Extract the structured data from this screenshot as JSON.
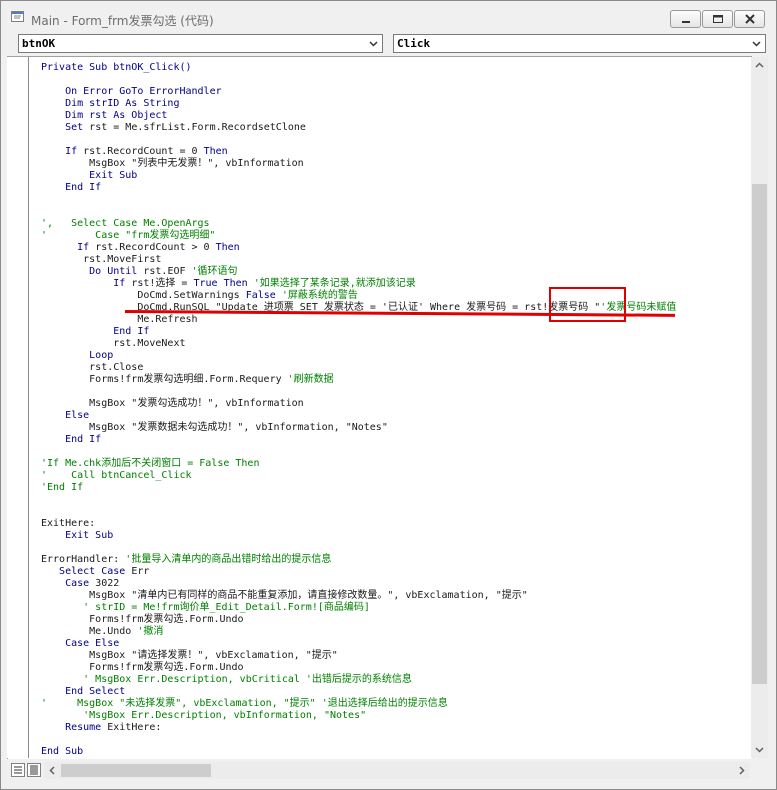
{
  "window": {
    "title": "Main - Form_frm发票勾选 (代码)"
  },
  "object_combo": {
    "value": "btnOK"
  },
  "proc_combo": {
    "value": "Click"
  },
  "code": [
    [
      [
        "kw",
        "Private Sub btnOK_Click()"
      ]
    ],
    [],
    [
      [
        "kw",
        "    On Error GoTo ErrorHandler"
      ]
    ],
    [
      [
        "kw",
        "    Dim strID As String"
      ]
    ],
    [
      [
        "kw",
        "    Dim rst As Object"
      ]
    ],
    [
      [
        "kw",
        "    Set "
      ],
      [
        "t",
        "rst = Me.sfrList.Form.RecordsetClone"
      ]
    ],
    [],
    [
      [
        "kw",
        "    If "
      ],
      [
        "t",
        "rst.RecordCount = 0 "
      ],
      [
        "kw",
        "Then"
      ]
    ],
    [
      [
        "t",
        "        MsgBox \"列表中无发票！\", vbInformation"
      ]
    ],
    [
      [
        "kw",
        "        Exit Sub"
      ]
    ],
    [
      [
        "kw",
        "    End If"
      ]
    ],
    [],
    [],
    [
      [
        "cm",
        "',   Select Case Me.OpenArgs"
      ]
    ],
    [
      [
        "cm",
        "'        Case \"frm发票勾选明细\""
      ]
    ],
    [
      [
        "kw",
        "      If "
      ],
      [
        "t",
        "rst.RecordCount > 0 "
      ],
      [
        "kw",
        "Then"
      ]
    ],
    [
      [
        "t",
        "       rst.MoveFirst"
      ]
    ],
    [
      [
        "kw",
        "        Do Until "
      ],
      [
        "t",
        "rst.EOF "
      ],
      [
        "cm",
        "'循环语句"
      ]
    ],
    [
      [
        "kw",
        "            If "
      ],
      [
        "t",
        "rst!选择 = "
      ],
      [
        "kw",
        "True Then "
      ],
      [
        "cm",
        "'如果选择了某条记录,就添加该记录"
      ]
    ],
    [
      [
        "t",
        "                DoCmd.SetWarnings "
      ],
      [
        "kw",
        "False "
      ],
      [
        "cm",
        "'屏蔽系统的警告"
      ]
    ],
    [
      [
        "t",
        "                DoCmd.RunSQL \"Update 进项票 SET 发票状态 = '已认证' Where 发票号码 = rst!发票号码 \""
      ],
      [
        "cm",
        "'发票号码未赋值"
      ]
    ],
    [
      [
        "t",
        "                Me.Refresh"
      ]
    ],
    [
      [
        "kw",
        "            End If"
      ]
    ],
    [
      [
        "t",
        "            rst.MoveNext"
      ]
    ],
    [
      [
        "kw",
        "        Loop"
      ]
    ],
    [
      [
        "t",
        "        rst.Close"
      ]
    ],
    [
      [
        "t",
        "        Forms!frm发票勾选明细.Form.Requery "
      ],
      [
        "cm",
        "'刷新数据"
      ]
    ],
    [],
    [
      [
        "t",
        "        MsgBox \"发票勾选成功！\", vbInformation"
      ]
    ],
    [
      [
        "kw",
        "    Else"
      ]
    ],
    [
      [
        "t",
        "        MsgBox \"发票数据未勾选成功！\", vbInformation, \"Notes\""
      ]
    ],
    [
      [
        "kw",
        "    End If"
      ]
    ],
    [],
    [
      [
        "cm",
        "'If Me.chk添加后不关闭窗口 = False Then"
      ]
    ],
    [
      [
        "cm",
        "'    Call btnCancel_Click"
      ]
    ],
    [
      [
        "cm",
        "'End If"
      ]
    ],
    [],
    [],
    [
      [
        "t",
        "ExitHere:"
      ]
    ],
    [
      [
        "kw",
        "    Exit Sub"
      ]
    ],
    [],
    [
      [
        "t",
        "ErrorHandler: "
      ],
      [
        "cm",
        "'批量导入清单内的商品出错时给出的提示信息"
      ]
    ],
    [
      [
        "kw",
        "   Select Case "
      ],
      [
        "t",
        "Err"
      ]
    ],
    [
      [
        "kw",
        "    Case "
      ],
      [
        "t",
        "3022"
      ]
    ],
    [
      [
        "t",
        "        MsgBox \"清单内已有同样的商品不能重复添加，请直接修改数量。\", vbExclamation, \"提示\""
      ]
    ],
    [
      [
        "cm",
        "       ' strID = Me!frm询价单_Edit_Detail.Form![商品编码]"
      ]
    ],
    [
      [
        "t",
        "        Forms!frm发票勾选.Form.Undo"
      ]
    ],
    [
      [
        "t",
        "        Me.Undo "
      ],
      [
        "cm",
        "'撤消"
      ]
    ],
    [
      [
        "kw",
        "    Case Else"
      ]
    ],
    [
      [
        "t",
        "        MsgBox \"请选择发票！\", vbExclamation, \"提示\""
      ]
    ],
    [
      [
        "t",
        "        Forms!frm发票勾选.Form.Undo"
      ]
    ],
    [
      [
        "cm",
        "       ' MsgBox Err.Description, vbCritical '出错后提示的系统信息"
      ]
    ],
    [
      [
        "kw",
        "    End Select"
      ]
    ],
    [
      [
        "cm",
        "'     MsgBox \"未选择发票\", vbExclamation, \"提示\" '退出选择后给出的提示信息"
      ]
    ],
    [
      [
        "cm",
        "       'MsgBox Err.Description, vbInformation, \"Notes\""
      ]
    ],
    [
      [
        "kw",
        "    Resume "
      ],
      [
        "t",
        "ExitHere:"
      ]
    ],
    [],
    [
      [
        "kw",
        "End Sub"
      ]
    ]
  ]
}
